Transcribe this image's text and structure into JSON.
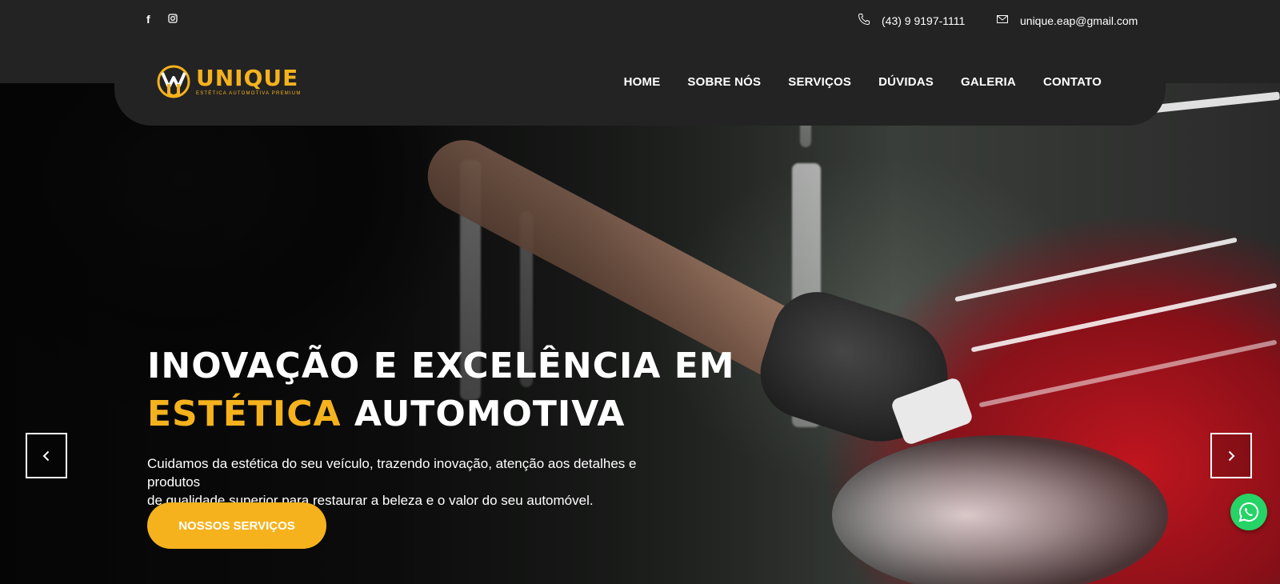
{
  "topbar": {
    "social": [
      {
        "icon": "facebook-icon",
        "glyph": "f"
      },
      {
        "icon": "instagram-icon",
        "glyph": "◘"
      }
    ],
    "phone": "(43) 9 9197-1111",
    "email": "unique.eap@gmail.com"
  },
  "logo": {
    "brand": "UNIQUE",
    "tagline": "ESTÉTICA AUTOMOTIVA PREMIUM"
  },
  "nav": {
    "items": [
      "HOME",
      "SOBRE NÓS",
      "SERVIÇOS",
      "DÚVIDAS",
      "GALERIA",
      "CONTATO"
    ]
  },
  "hero": {
    "title_line1": "INOVAÇÃO E EXCELÊNCIA EM",
    "title_accent": "ESTÉTICA",
    "title_line2_rest": "AUTOMOTIVA",
    "description_line1": "Cuidamos da estética do seu veículo, trazendo inovação, atenção aos detalhes e produtos",
    "description_line2": "de qualidade superior para restaurar a beleza e o valor do seu automóvel.",
    "cta_label": "NOSSOS SERVIÇOS"
  },
  "colors": {
    "accent": "#f5b21d",
    "bar_bg": "#232323",
    "whatsapp": "#25d366"
  }
}
